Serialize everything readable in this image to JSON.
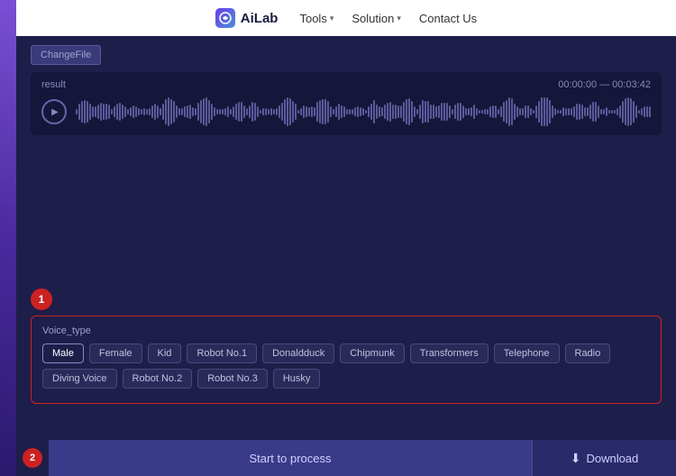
{
  "header": {
    "logo_text": "AiLab",
    "logo_icon": "AI",
    "nav": [
      {
        "label": "Tools",
        "has_arrow": true
      },
      {
        "label": "Solution",
        "has_arrow": true
      },
      {
        "label": "Contact Us",
        "has_arrow": false
      }
    ]
  },
  "toolbar": {
    "change_file_label": "ChangeFile"
  },
  "audio_player": {
    "result_label": "result",
    "time_range": "00:00:00 — 00:03:42"
  },
  "step1": {
    "number": "1"
  },
  "voice_type": {
    "label": "Voice_type",
    "buttons_row1": [
      {
        "label": "Male",
        "active": true
      },
      {
        "label": "Female",
        "active": false
      },
      {
        "label": "Kid",
        "active": false
      },
      {
        "label": "Robot No.1",
        "active": false
      },
      {
        "label": "Donaldduck",
        "active": false
      },
      {
        "label": "Chipmunk",
        "active": false
      },
      {
        "label": "Transformers",
        "active": false
      },
      {
        "label": "Telephone",
        "active": false
      },
      {
        "label": "Radio",
        "active": false
      }
    ],
    "buttons_row2": [
      {
        "label": "Diving Voice",
        "active": false
      },
      {
        "label": "Robot No.2",
        "active": false
      },
      {
        "label": "Robot No.3",
        "active": false
      },
      {
        "label": "Husky",
        "active": false
      }
    ]
  },
  "action_bar": {
    "step2_number": "2",
    "start_process_label": "Start to process",
    "download_label": "Download"
  }
}
